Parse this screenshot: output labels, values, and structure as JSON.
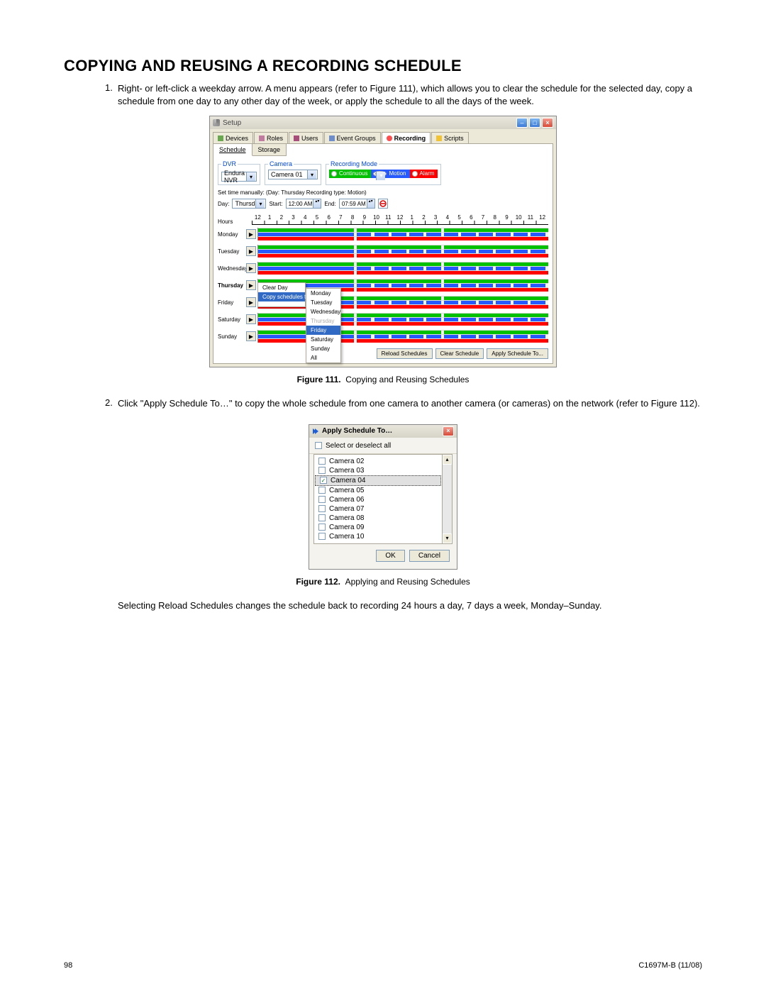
{
  "heading": "COPYING AND REUSING A RECORDING SCHEDULE",
  "steps": {
    "s1_num": "1.",
    "s1_txt": "Right- or left-click a weekday arrow. A menu appears (refer to Figure 111), which allows you to clear the schedule for the selected day, copy a schedule from one day to any other day of the week, or apply the schedule to all the days of the week.",
    "s2_num": "2.",
    "s2_txt": "Click \"Apply Schedule To…\" to copy the whole schedule from one camera to another camera (or cameras) on the network (refer to Figure 112)."
  },
  "fig111": {
    "caption_b": "Figure 111.",
    "caption_t": "Copying and Reusing Schedules",
    "title": "Setup",
    "tabs": [
      "Devices",
      "Roles",
      "Users",
      "Event Groups",
      "Recording",
      "Scripts"
    ],
    "subtabs": [
      "Schedule",
      "Storage"
    ],
    "dvr_legend": "DVR",
    "dvr_value": "Endura NVR",
    "cam_legend": "Camera",
    "cam_value": "Camera 01",
    "mode_legend": "Recording Mode",
    "mode_continuous": "Continuous",
    "mode_motion": "Motion",
    "mode_alarm": "Alarm",
    "manual": "Set time manually: (Day: Thursday  Recording type:  Motion)",
    "day_lbl": "Day:",
    "day_val": "Thursday",
    "start_lbl": "Start:",
    "start_val": "12:00 AM",
    "end_lbl": "End:",
    "end_val": "07:59 AM",
    "hours_lbl": "Hours",
    "hour_nums": [
      "12",
      "1",
      "2",
      "3",
      "4",
      "5",
      "6",
      "7",
      "8",
      "9",
      "10",
      "11",
      "12",
      "1",
      "2",
      "3",
      "4",
      "5",
      "6",
      "7",
      "8",
      "9",
      "10",
      "11",
      "12"
    ],
    "days": [
      "Monday",
      "Tuesday",
      "Wednesday",
      "Thursday",
      "Friday",
      "Saturday",
      "Sunday"
    ],
    "ctx": {
      "clear": "Clear Day",
      "copy": "Copy schedules to",
      "sub": [
        "Monday",
        "Tuesday",
        "Wednesday",
        "Thursday",
        "Friday",
        "Saturday",
        "Sunday",
        "All"
      ]
    },
    "btns": [
      "Reload Schedules",
      "Clear Schedule",
      "Apply Schedule To..."
    ]
  },
  "fig112": {
    "caption_b": "Figure 112.",
    "caption_t": "Applying and Reusing Schedules",
    "title": "Apply Schedule To…",
    "select_all": "Select or deselect all",
    "items": [
      {
        "label": "Camera 02",
        "checked": false
      },
      {
        "label": "Camera 03",
        "checked": false
      },
      {
        "label": "Camera 04",
        "checked": true,
        "selected": true
      },
      {
        "label": "Camera 05",
        "checked": false
      },
      {
        "label": "Camera 06",
        "checked": false
      },
      {
        "label": "Camera 07",
        "checked": false
      },
      {
        "label": "Camera 08",
        "checked": false
      },
      {
        "label": "Camera 09",
        "checked": false
      },
      {
        "label": "Camera 10",
        "checked": false
      }
    ],
    "ok": "OK",
    "cancel": "Cancel"
  },
  "p_after": "Selecting Reload Schedules changes the schedule back to recording 24 hours a day, 7 days a week, Monday–Sunday.",
  "footer": {
    "page": "98",
    "doc": "C1697M-B (11/08)"
  }
}
